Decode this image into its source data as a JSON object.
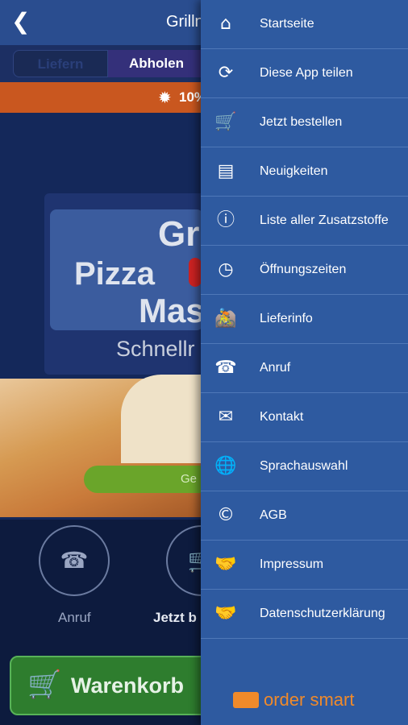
{
  "app": {
    "title": "Grilln",
    "back_icon": "arrow-left-icon",
    "tabs": [
      "Liefern",
      "Abholen"
    ],
    "promo": "10%",
    "logo": {
      "line1": "Gr",
      "line2": "Pizza",
      "line3": "Mas",
      "subtitle": "Schnellr"
    },
    "pizza_button": "Ge",
    "actions": [
      {
        "label": "Anruf",
        "icon": "phone-icon"
      },
      {
        "label": "Jetzt b",
        "icon": "cart-icon"
      }
    ],
    "cart_button": "Warenkorb"
  },
  "drawer": {
    "items": [
      {
        "label": "Startseite",
        "icon": "home-icon"
      },
      {
        "label": "Diese App teilen",
        "icon": "share-icon"
      },
      {
        "label": "Jetzt bestellen",
        "icon": "cart-icon"
      },
      {
        "label": "Neuigkeiten",
        "icon": "news-icon"
      },
      {
        "label": "Liste aller Zusatzstoffe",
        "icon": "info-icon"
      },
      {
        "label": "Öffnungszeiten",
        "icon": "clock-icon"
      },
      {
        "label": "Lieferinfo",
        "icon": "motorbike-icon"
      },
      {
        "label": "Anruf",
        "icon": "phone-icon"
      },
      {
        "label": "Kontakt",
        "icon": "envelope-icon"
      },
      {
        "label": "Sprachauswahl",
        "icon": "globe-icon"
      },
      {
        "label": "AGB",
        "icon": "copyright-icon"
      },
      {
        "label": "Impressum",
        "icon": "handshake-icon"
      },
      {
        "label": "Datenschutzerklärung",
        "icon": "handshake-icon"
      }
    ],
    "brand": "order smart"
  },
  "colors": {
    "drawer_bg": "#2e5aa0",
    "topbar": "#2a4d8f",
    "promo": "#c9571f",
    "brand": "#f08a2a",
    "cart_button": "#2e7d2e"
  }
}
